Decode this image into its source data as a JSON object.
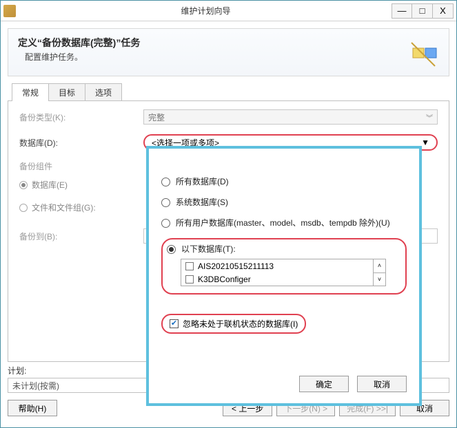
{
  "window": {
    "title": "维护计划向导",
    "minimize": "—",
    "maximize": "□",
    "close": "X"
  },
  "header": {
    "title": "定义“备份数据库(完整)”任务",
    "subtitle": "配置维护任务。"
  },
  "tabs": {
    "general": "常规",
    "target": "目标",
    "options": "选项"
  },
  "form": {
    "backup_type_label": "备份类型(K):",
    "backup_type_value": "完整",
    "database_label": "数据库(D):",
    "database_value": "<选择一项或多项>",
    "component_label": "备份组件",
    "component_db": "数据库(E)",
    "component_fg": "文件和文件组(G):",
    "backup_to_label": "备份到(B):"
  },
  "popup": {
    "opt_all": "所有数据库(D)",
    "opt_sys": "系统数据库(S)",
    "opt_user": "所有用户数据库(master、model、msdb、tempdb 除外)(U)",
    "opt_these": "以下数据库(T):",
    "db1": "AIS20210515211113",
    "db2": "K3DBConfiger",
    "ignore_offline": "忽略未处于联机状态的数据库(I)",
    "ok": "确定",
    "cancel": "取消"
  },
  "plan": {
    "label": "计划:",
    "value": "未计划(按需)"
  },
  "wizard": {
    "help": "帮助(H)",
    "prev": "< 上一步",
    "next": "下一步(N) >",
    "finish": "完成(F) >>|",
    "cancel": "取消"
  }
}
